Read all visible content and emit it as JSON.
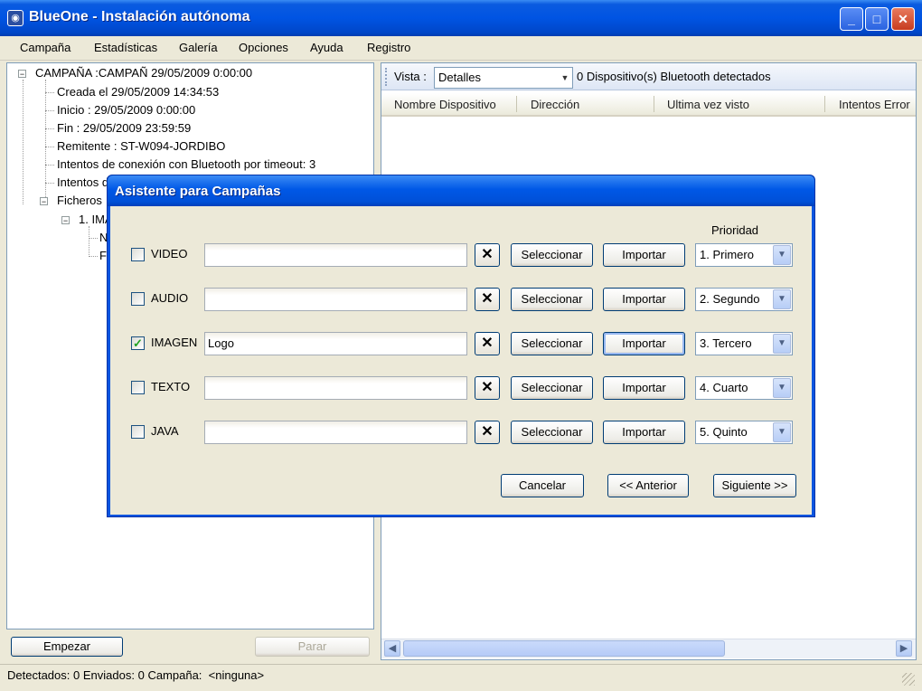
{
  "window": {
    "title": "BlueOne - Instalación autónoma",
    "controls": {
      "minimize": "_",
      "maximize": "□",
      "close": "✕"
    }
  },
  "menu": [
    "Campaña",
    "Estadísticas",
    "Galería",
    "Opciones",
    "Ayuda",
    "Registro"
  ],
  "tree": {
    "root": "CAMPAÑA :CAMPAÑ 29/05/2009 0:00:00",
    "items": [
      "Creada el 29/05/2009 14:34:53",
      "Inicio : 29/05/2009 0:00:00",
      "Fin : 29/05/2009 23:59:59",
      "Remitente : ST-W094-JORDIBO",
      "Intentos de conexión con Bluetooth por timeout: 3",
      "Intentos d"
    ],
    "ficheros": "Ficheros",
    "sub": "1. IMA",
    "sub_children": [
      "N",
      "F"
    ]
  },
  "left_buttons": {
    "start": "Empezar",
    "stop": "Parar"
  },
  "view": {
    "label": "Vista :",
    "selected": "Detalles",
    "status": "0 Dispositivo(s) Bluetooth detectados"
  },
  "columns": [
    "Nombre Dispositivo",
    "Dirección",
    "Ultima vez visto",
    "Intentos Error"
  ],
  "statusbar": {
    "detected_label": "Detectados:",
    "detected_value": "0",
    "sent_label": "Enviados:",
    "sent_value": "0",
    "campaign_label": "Campaña:",
    "campaign_value": "<ninguna>"
  },
  "dialog": {
    "title": "Asistente para Campañas",
    "priority_header": "Prioridad",
    "rows": [
      {
        "label": "VIDEO",
        "checked": false,
        "value": "",
        "clear": "✕",
        "select": "Seleccionar",
        "import": "Importar",
        "priority": "1. Primero"
      },
      {
        "label": "AUDIO",
        "checked": false,
        "value": "",
        "clear": "✕",
        "select": "Seleccionar",
        "import": "Importar",
        "priority": "2. Segundo"
      },
      {
        "label": "IMAGEN",
        "checked": true,
        "value": "Logo",
        "clear": "✕",
        "select": "Seleccionar",
        "import": "Importar",
        "priority": "3. Tercero"
      },
      {
        "label": "TEXTO",
        "checked": false,
        "value": "",
        "clear": "✕",
        "select": "Seleccionar",
        "import": "Importar",
        "priority": "4. Cuarto"
      },
      {
        "label": "JAVA",
        "checked": false,
        "value": "",
        "clear": "✕",
        "select": "Seleccionar",
        "import": "Importar",
        "priority": "5. Quinto"
      }
    ],
    "buttons": {
      "cancel": "Cancelar",
      "back": "<< Anterior",
      "next": "Siguiente >>"
    }
  },
  "icons": {
    "app": "bluetooth-app-icon",
    "checkmark": "✓",
    "combo_arrow": "▼",
    "scroll_left": "◀",
    "scroll_right": "▶"
  }
}
